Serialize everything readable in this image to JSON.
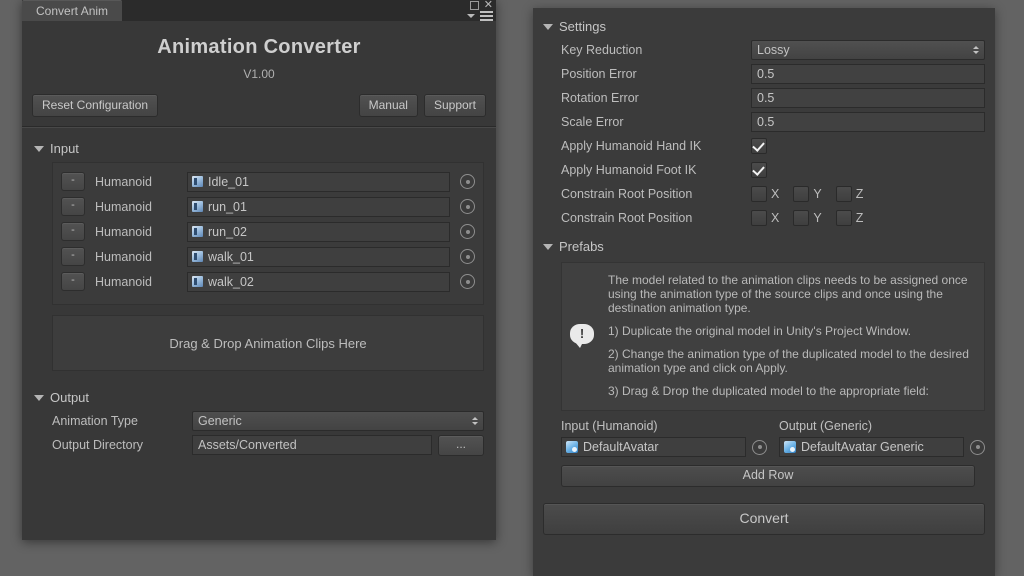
{
  "window": {
    "tab_label": "Convert Anim",
    "controls": {
      "maximize_icon": "maximize-icon",
      "close_icon": "close-icon",
      "menu_icon": "hamburger-menu-icon"
    },
    "title": "Animation Converter",
    "version": "V1.00",
    "reset_label": "Reset Configuration",
    "manual_label": "Manual",
    "support_label": "Support"
  },
  "input": {
    "header": "Input",
    "rows": [
      {
        "remove_label": "-",
        "type": "Humanoid",
        "clip": "Idle_01"
      },
      {
        "remove_label": "-",
        "type": "Humanoid",
        "clip": "run_01"
      },
      {
        "remove_label": "-",
        "type": "Humanoid",
        "clip": "run_02"
      },
      {
        "remove_label": "-",
        "type": "Humanoid",
        "clip": "walk_01"
      },
      {
        "remove_label": "-",
        "type": "Humanoid",
        "clip": "walk_02"
      }
    ],
    "dropzone_label": "Drag & Drop Animation Clips Here"
  },
  "output": {
    "header": "Output",
    "animation_type_label": "Animation Type",
    "animation_type_value": "Generic",
    "output_directory_label": "Output Directory",
    "output_directory_value": "Assets/Converted",
    "browse_label": "..."
  },
  "settings": {
    "header": "Settings",
    "key_reduction_label": "Key Reduction",
    "key_reduction_value": "Lossy",
    "position_error_label": "Position Error",
    "position_error_value": "0.5",
    "rotation_error_label": "Rotation Error",
    "rotation_error_value": "0.5",
    "scale_error_label": "Scale Error",
    "scale_error_value": "0.5",
    "hand_ik_label": "Apply Humanoid Hand IK",
    "hand_ik_checked": true,
    "foot_ik_label": "Apply Humanoid Foot IK",
    "foot_ik_checked": true,
    "constrain_rows": [
      {
        "label": "Constrain Root Position",
        "x": "X",
        "y": "Y",
        "z": "Z",
        "x_checked": false,
        "y_checked": false,
        "z_checked": false
      },
      {
        "label": "Constrain Root Position",
        "x": "X",
        "y": "Y",
        "z": "Z",
        "x_checked": false,
        "y_checked": false,
        "z_checked": false
      }
    ]
  },
  "prefabs": {
    "header": "Prefabs",
    "help_icon": "info-bubble-icon",
    "help_mark": "!",
    "help_paragraphs": [
      "The model related to the animation clips needs to be assigned once using the animation type of the source clips and once using the destination animation type.",
      "1) Duplicate the original model in Unity's Project Window.",
      "2) Change the animation type of the duplicated model to the desired animation type and click on Apply.",
      "3) Drag & Drop the duplicated model to the appropriate field:"
    ],
    "input_caption": "Input (Humanoid)",
    "input_value": "DefaultAvatar",
    "output_caption": "Output (Generic)",
    "output_value": "DefaultAvatar Generic",
    "add_row_label": "Add Row"
  },
  "footer": {
    "convert_label": "Convert"
  },
  "colors": {
    "page_bg": "#636363",
    "panel_bg": "#383838",
    "panel_bg_alt": "#3b3b3b",
    "field_bg": "#3f3f3f",
    "text": "#bdbdbd",
    "accent_icon": "#6fb5e8"
  }
}
